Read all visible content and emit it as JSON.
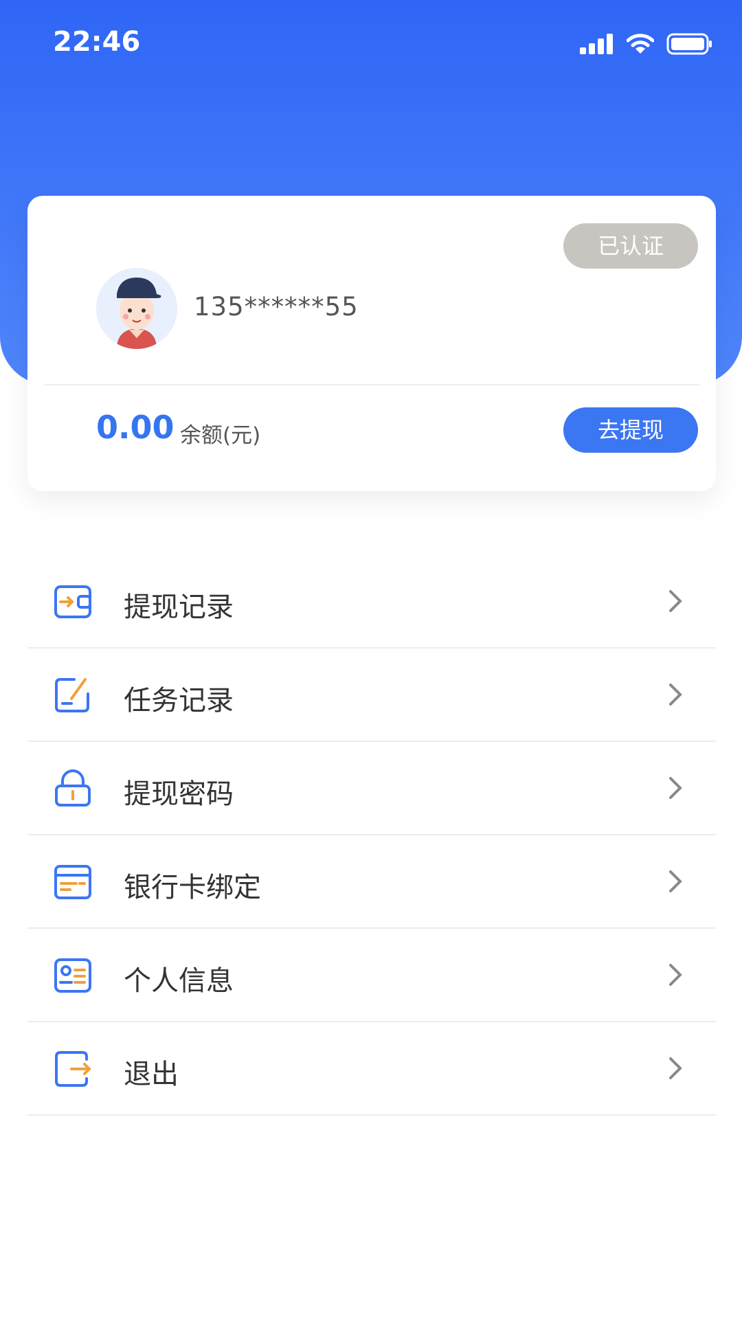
{
  "status_bar": {
    "time": "22:46"
  },
  "profile": {
    "verified_label": "已认证",
    "phone": "135******55",
    "balance_value": "0.00",
    "balance_label": "余额(元)",
    "withdraw_button": "去提现"
  },
  "menu": [
    {
      "label": "提现记录",
      "icon": "wallet-arrow-icon"
    },
    {
      "label": "任务记录",
      "icon": "edit-task-icon"
    },
    {
      "label": "提现密码",
      "icon": "lock-icon"
    },
    {
      "label": "银行卡绑定",
      "icon": "bank-card-icon"
    },
    {
      "label": "个人信息",
      "icon": "id-card-icon"
    },
    {
      "label": "退出",
      "icon": "logout-icon"
    }
  ],
  "colors": {
    "primary": "#3575f0",
    "header_gradient_top": "#2f66f6",
    "header_gradient_bottom": "#4f86fb",
    "icon_orange": "#f0a03c",
    "badge_gray": "#c8c5c0"
  }
}
